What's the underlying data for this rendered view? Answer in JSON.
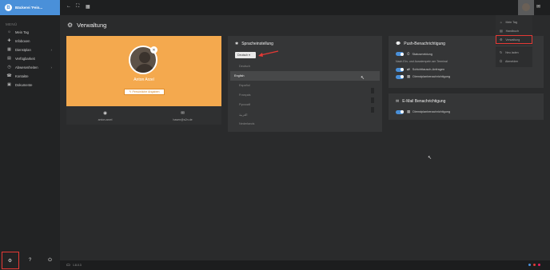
{
  "brand": {
    "logo": "B",
    "title": "Bäckerei 'Fein..."
  },
  "sidebar": {
    "heading": "MENÜ",
    "items": [
      {
        "icon": "☼",
        "label": "Mein Tag",
        "chevron": ""
      },
      {
        "icon": "✚",
        "label": "Infoboxen",
        "chevron": ""
      },
      {
        "icon": "▦",
        "label": "Dienstplan",
        "chevron": "›"
      },
      {
        "icon": "▤",
        "label": "Verfügbarkeit",
        "chevron": ""
      },
      {
        "icon": "◷",
        "label": "Abwesenheiten",
        "chevron": "›"
      },
      {
        "icon": "☎",
        "label": "Kontakte",
        "chevron": ""
      },
      {
        "icon": "▣",
        "label": "Dokumente",
        "chevron": ""
      }
    ],
    "bottom": {
      "settings_icon": "⚙",
      "help_icon": "?",
      "power_icon": "⏻"
    }
  },
  "topbar": {
    "back_icon": "←",
    "fullscreen_icon": "⛶",
    "grid_icon": "▦",
    "chat_icon": "✉"
  },
  "page": {
    "title": "Verwaltung",
    "title_icon": "⚙"
  },
  "profile": {
    "name": "Anton Arzel",
    "edit_button": "✎ Persönliche Angaben",
    "close_icon": "✕",
    "user_icon": "◉",
    "user": "anton.arzel",
    "mail_icon": "✉",
    "email": "hasen@s2n.de"
  },
  "language": {
    "icon": "✱",
    "title": "Spracheinstellung",
    "selected": "Deutsch ▾",
    "options": [
      "Deutsch",
      "English",
      "Español",
      "Français",
      "Русский",
      "العربية",
      "Nederlands"
    ],
    "highlighted_index": 1,
    "cursor_icon": "↖"
  },
  "push": {
    "icon": "💬",
    "title": "Push-Benachrichtigung",
    "note": "Nach Ein- und Ausstempeln am Terminal",
    "rows": [
      {
        "icon": "⏱",
        "label": "Statusmeldung"
      },
      {
        "icon": "⇄",
        "label": "Schichttausch-Anfragen"
      },
      {
        "icon": "▦",
        "label": "Dienstplanbenachrichtigung"
      }
    ]
  },
  "mail": {
    "icon": "✉",
    "title": "E-Mail Benachrichtigung",
    "rows": [
      {
        "icon": "▦",
        "label": "Dienstplanbenachrichtigung"
      }
    ]
  },
  "user_menu": {
    "items": [
      {
        "icon": "☼",
        "label": "Mein Tag"
      },
      {
        "icon": "▤",
        "label": "Handbuch"
      },
      {
        "icon": "⚙",
        "label": "Verwaltung"
      },
      {
        "icon": "↻",
        "label": "Neu laden"
      },
      {
        "icon": "⏻",
        "label": "Abmelden"
      }
    ]
  },
  "footer": {
    "icon": "▭",
    "version": "1.8.0.3",
    "dot_colors": [
      "#4a90d9",
      "#e53935",
      "#e91e63"
    ]
  },
  "colors": {
    "accent": "#4a90d9",
    "profile_bg": "#f4a94e",
    "highlight": "#e53935"
  }
}
